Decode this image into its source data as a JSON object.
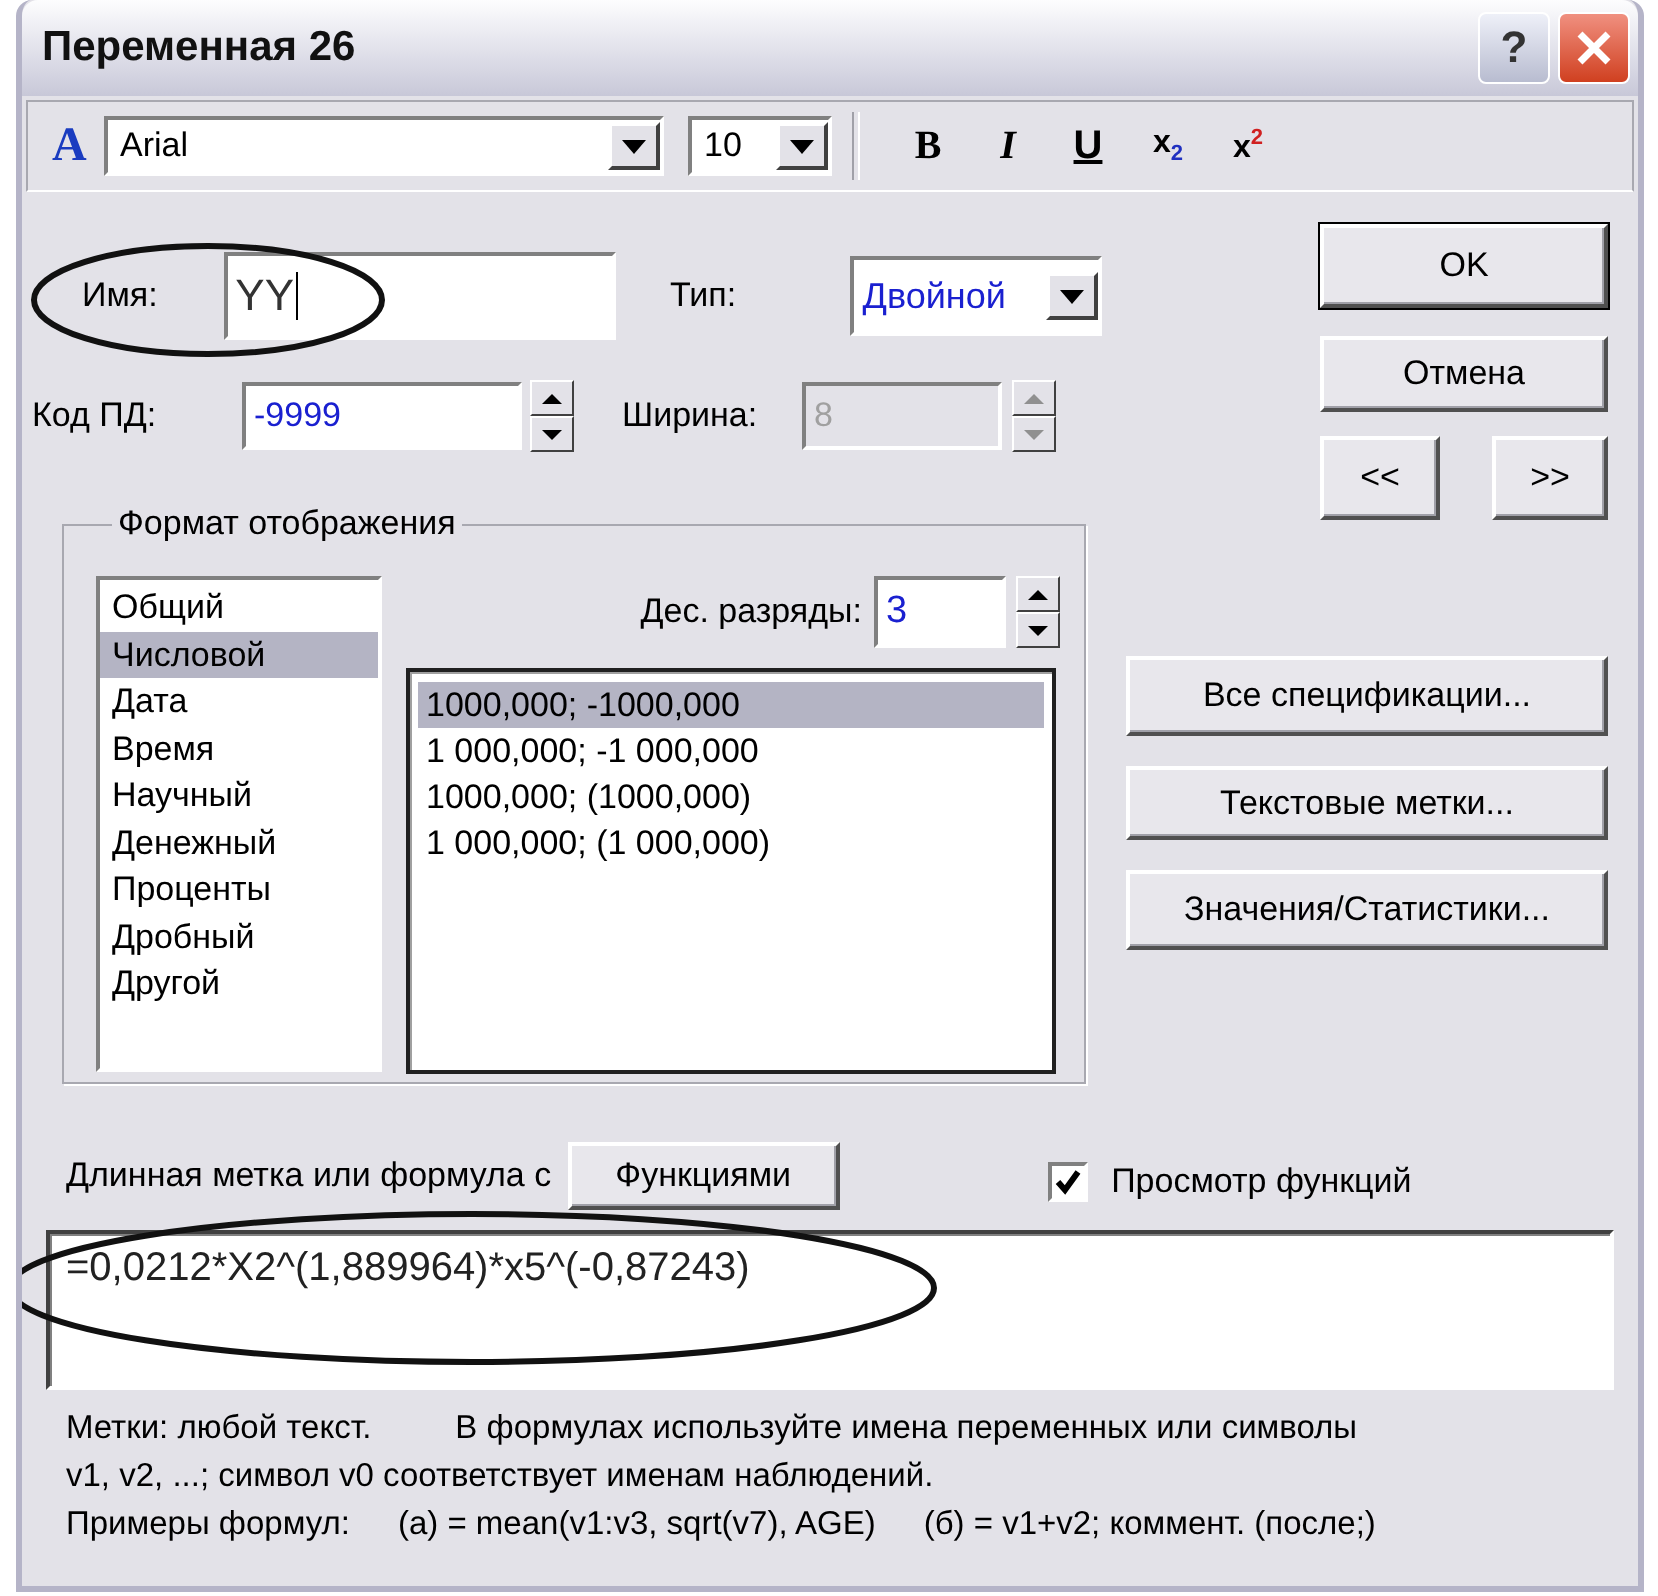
{
  "window": {
    "title": "Переменная 26",
    "help_button": "?"
  },
  "toolbar": {
    "font_icon": "A",
    "font": "Arial",
    "size": "10",
    "buttons": [
      {
        "kind": "bold",
        "label": "B"
      },
      {
        "kind": "italic",
        "label": "I"
      },
      {
        "kind": "underline",
        "label": "U"
      },
      {
        "kind": "subscript",
        "label": "x",
        "mark": "2"
      },
      {
        "kind": "superscript",
        "label": "x",
        "mark": "2"
      }
    ]
  },
  "fields": {
    "name": {
      "label": "Имя:",
      "value": "YY"
    },
    "type": {
      "label": "Тип:",
      "value": "Двойной"
    },
    "missing_code": {
      "label": "Код ПД:",
      "value": "-9999"
    },
    "width": {
      "label": "Ширина:",
      "value": "8",
      "disabled": true
    }
  },
  "format_group": {
    "title": "Формат отображения",
    "categories": [
      {
        "label": "Общий",
        "selected": false
      },
      {
        "label": "Числовой",
        "selected": true
      },
      {
        "label": "Дата",
        "selected": false
      },
      {
        "label": "Время",
        "selected": false
      },
      {
        "label": "Научный",
        "selected": false
      },
      {
        "label": "Денежный",
        "selected": false
      },
      {
        "label": "Проценты",
        "selected": false
      },
      {
        "label": "Дробный",
        "selected": false
      },
      {
        "label": "Другой",
        "selected": false
      }
    ],
    "decimals": {
      "label": "Дес. разряды:",
      "value": "3"
    },
    "formats": [
      {
        "label": "1000,000; -1000,000",
        "selected": true
      },
      {
        "label": "1 000,000; -1 000,000",
        "selected": false
      },
      {
        "label": "1000,000; (1000,000)",
        "selected": false
      },
      {
        "label": "1 000,000; (1 000,000)",
        "selected": false
      }
    ]
  },
  "buttons": {
    "ok": "OK",
    "cancel": "Отмена",
    "prev": "<<",
    "next": ">>",
    "side": [
      "Все спецификации...",
      "Текстовые метки...",
      "Значения/Статистики..."
    ]
  },
  "formula": {
    "label": "Длинная метка или формула с",
    "functions_button": "Функциями",
    "preview": {
      "label": "Просмотр функций",
      "checked": true
    },
    "value": "=0,0212*X2^(1,889964)*x5^(-0,87243)"
  },
  "notes": [
    [
      "Метки: любой текст.",
      "В формулах используйте имена переменных или символы"
    ],
    [
      "v1, v2, ...; символ v0 соответствует именам наблюдений."
    ],
    [
      "Примеры формул:",
      "(а) = mean(v1:v3, sqrt(v7), AGE)",
      "(б) = v1+v2; коммент. (после;)"
    ]
  ]
}
